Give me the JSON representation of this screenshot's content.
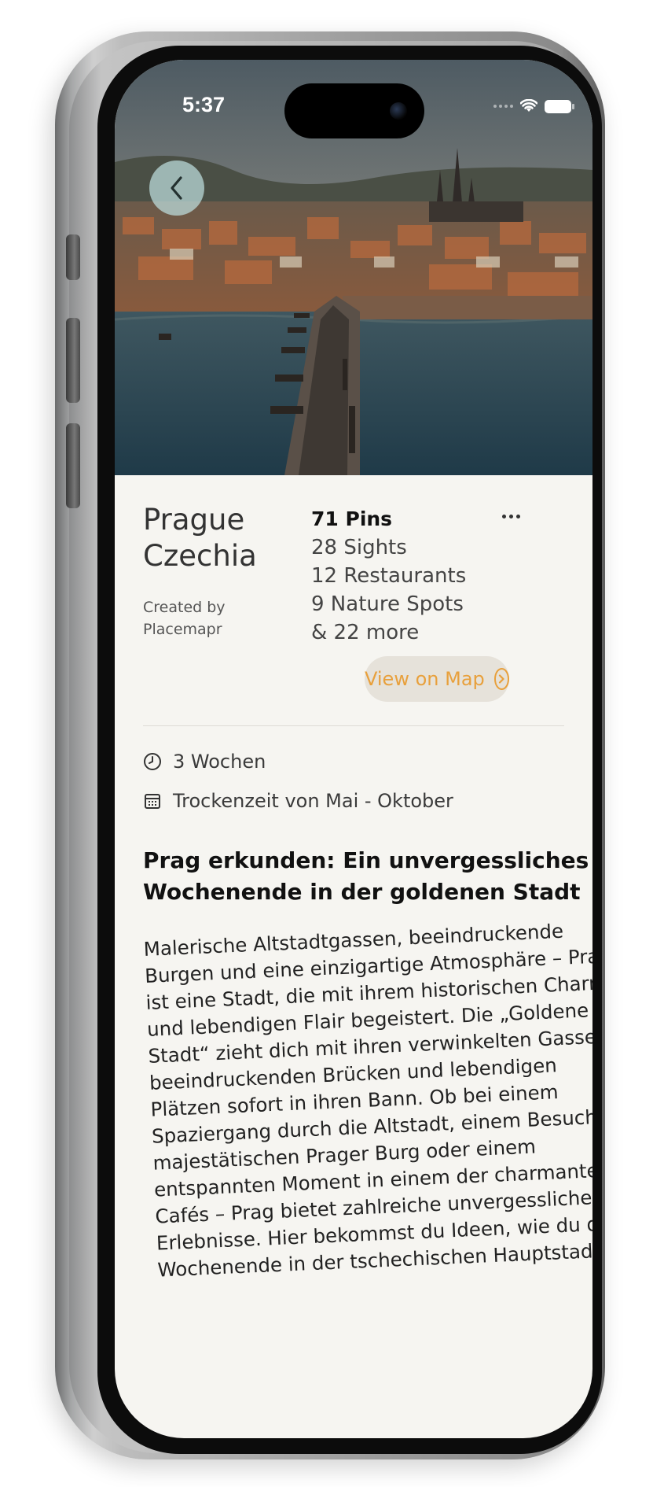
{
  "status_bar": {
    "time": "5:37"
  },
  "hero": {
    "image_description_icon": "prague-cityscape-photo"
  },
  "back_button": {
    "icon": "chevron-left-icon"
  },
  "guide": {
    "place_lines": [
      "Prague",
      "Czechia"
    ],
    "creator_lines": [
      "Created by",
      "Placemapr"
    ],
    "pin_total": "71 Pins",
    "pin_categories": [
      "28 Sights",
      "12 Restaurants",
      "9 Nature Spots",
      "& 22 more"
    ],
    "map_button_label": "View on Map",
    "duration": "3 Wochen",
    "season": "Trockenzeit von Mai - Oktober",
    "headline_lines": [
      "Prag erkunden: Ein unvergessliches",
      "Wochenende in der goldenen Stadt"
    ],
    "body_lines": [
      "Malerische Altstadtgassen, beeindruckende",
      "Burgen und eine einzigartige Atmosphäre – Prag",
      "ist eine Stadt, die mit ihrem historischen Charme",
      "und lebendigen Flair begeistert. Die „Goldene",
      "Stadt“ zieht dich mit ihren verwinkelten Gassen,",
      "beeindruckenden Brücken und lebendigen",
      "Plätzen sofort in ihren Bann. Ob bei einem",
      "Spaziergang durch die Altstadt, einem Besuch der",
      "majestätischen Prager Burg oder einem",
      "entspannten Moment in einem der charmanten",
      "Cafés – Prag bietet zahlreiche unvergessliche",
      "Erlebnisse. Hier bekommst du Ideen, wie du dein",
      "Wochenende in der tschechischen Hauptstadt zu"
    ]
  },
  "colors": {
    "accent": "#e8a03c",
    "background": "#f6f5f1",
    "chip": "#e6e2da"
  }
}
